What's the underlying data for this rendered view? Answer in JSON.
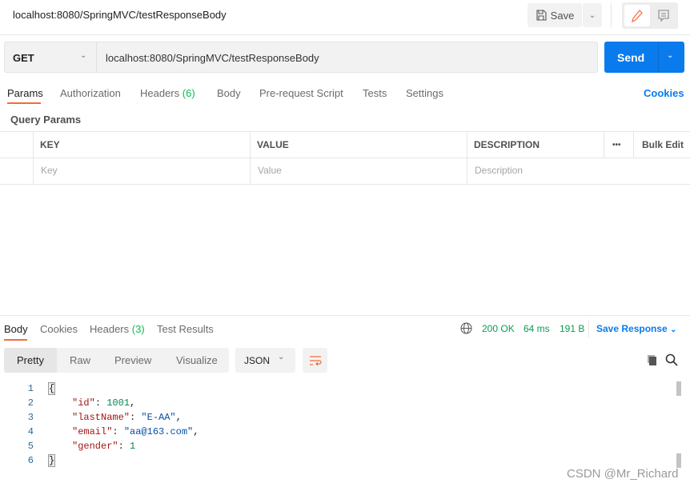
{
  "header": {
    "title": "localhost:8080/SpringMVC/testResponseBody",
    "save_label": "Save"
  },
  "request": {
    "method": "GET",
    "url": "localhost:8080/SpringMVC/testResponseBody",
    "send_label": "Send"
  },
  "tabs": [
    {
      "label": "Params",
      "active": true
    },
    {
      "label": "Authorization"
    },
    {
      "label": "Headers",
      "count": "(6)"
    },
    {
      "label": "Body"
    },
    {
      "label": "Pre-request Script"
    },
    {
      "label": "Tests"
    },
    {
      "label": "Settings"
    }
  ],
  "cookies_label": "Cookies",
  "query_params": {
    "title": "Query Params",
    "columns": [
      "KEY",
      "VALUE",
      "DESCRIPTION"
    ],
    "more": "•••",
    "bulk_edit": "Bulk Edit",
    "placeholders": [
      "Key",
      "Value",
      "Description"
    ]
  },
  "response": {
    "tabs": [
      {
        "label": "Body",
        "active": true
      },
      {
        "label": "Cookies"
      },
      {
        "label": "Headers",
        "count": "(3)"
      },
      {
        "label": "Test Results"
      }
    ],
    "status": "200 OK",
    "time": "64 ms",
    "size": "191 B",
    "save_response": "Save Response",
    "views": [
      "Pretty",
      "Raw",
      "Preview",
      "Visualize"
    ],
    "format": "JSON",
    "lines": [
      "1",
      "2",
      "3",
      "4",
      "5",
      "6"
    ],
    "body": {
      "open": "{",
      "id_key": "\"id\"",
      "id_val": "1001",
      "lastName_key": "\"lastName\"",
      "lastName_val": "\"E-AA\"",
      "email_key": "\"email\"",
      "email_val": "\"aa@163.com\"",
      "gender_key": "\"gender\"",
      "gender_val": "1",
      "close": "}"
    }
  },
  "watermark": "CSDN @Mr_Richard",
  "colors": {
    "accent": "#f26b3a",
    "send": "#097bed",
    "status": "#0c9c4f"
  }
}
